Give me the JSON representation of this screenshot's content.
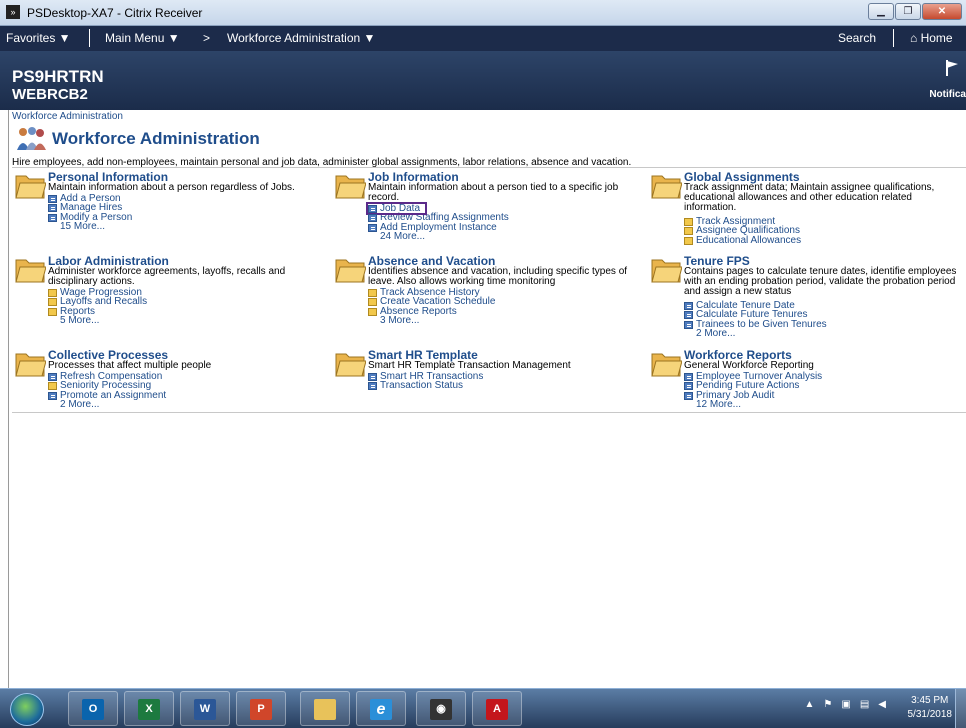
{
  "window": {
    "title": "PSDesktop-XA7 - Citrix Receiver"
  },
  "nav": {
    "favorites": "Favorites ▼",
    "main_menu": "Main Menu ▼",
    "arrow": ">",
    "crumb_menu": "Workforce Administration ▼",
    "search": "Search",
    "home": "Home"
  },
  "header": {
    "line1": "PS9HRTRN",
    "line2": "WEBRCB2",
    "notifications": "Notifica"
  },
  "breadcrumb": "Workforce Administration",
  "page": {
    "title": "Workforce Administration",
    "description": "Hire employees, add non-employees, maintain personal and job data, administer global assignments, labor relations, absence and vacation."
  },
  "sections": {
    "personal_information": {
      "title": "Personal Information",
      "desc": "Maintain information about a person regardless of Jobs.",
      "links": [
        "Add a Person",
        "Manage Hires",
        "Modify a Person"
      ],
      "more": "15 More..."
    },
    "job_information": {
      "title": "Job Information",
      "desc": "Maintain information about a person tied to a specific job record.",
      "links": [
        "Job Data",
        "Review Staffing Assignments",
        "Add Employment Instance"
      ],
      "more": "24 More..."
    },
    "global_assignments": {
      "title": "Global Assignments",
      "desc": "Track assignment data; Maintain assignee qualifications, educational allowances and other education related information.",
      "links": [
        "Track Assignment",
        "Assignee Qualifications",
        "Educational Allowances"
      ]
    },
    "labor_administration": {
      "title": "Labor Administration",
      "desc": "Administer workforce agreements, layoffs, recalls and disciplinary actions.",
      "links": [
        "Wage Progression",
        "Layoffs and Recalls",
        "Reports"
      ],
      "more": "5 More..."
    },
    "absence_vacation": {
      "title": "Absence and Vacation",
      "desc": "Identifies absence and vacation, including specific types of leave. Also allows working time monitoring",
      "links": [
        "Track Absence History",
        "Create Vacation Schedule",
        "Absence Reports"
      ],
      "more": "3 More..."
    },
    "tenure_fps": {
      "title": "Tenure FPS",
      "desc": "Contains pages to calculate tenure dates, identifie employees with an ending probation period, validate the probation period and assign a new status",
      "links": [
        "Calculate Tenure Date",
        "Calculate Future Tenures",
        "Trainees to be Given Tenures"
      ],
      "more": "2 More..."
    },
    "collective_processes": {
      "title": "Collective Processes",
      "desc": "Processes that affect multiple people",
      "links": [
        "Refresh Compensation",
        "Seniority Processing",
        "Promote an Assignment"
      ],
      "more": "2 More..."
    },
    "smart_hr_template": {
      "title": "Smart HR Template",
      "desc": "Smart HR Template Transaction Management",
      "links": [
        "Smart HR Transactions",
        "Transaction Status"
      ]
    },
    "workforce_reports": {
      "title": "Workforce Reports",
      "desc": "General Workforce Reporting",
      "links": [
        "Employee Turnover Analysis",
        "Pending Future Actions",
        "Primary Job Audit"
      ],
      "more": "12 More..."
    }
  },
  "taskbar": {
    "apps": [
      {
        "name": "outlook-icon",
        "label": "O",
        "color": "#0a64ad"
      },
      {
        "name": "excel-icon",
        "label": "X",
        "color": "#1d7a3f"
      },
      {
        "name": "word-icon",
        "label": "W",
        "color": "#2b5797"
      },
      {
        "name": "powerpoint-icon",
        "label": "P",
        "color": "#d0462a"
      },
      {
        "name": "explorer-icon",
        "label": "",
        "color": "#e8c25a"
      },
      {
        "name": "ie-icon",
        "label": "e",
        "color": "#2b8fd8"
      },
      {
        "name": "citrix-icon",
        "label": "◉",
        "color": "#333333"
      },
      {
        "name": "acrobat-icon",
        "label": "A",
        "color": "#c4161c"
      }
    ],
    "time": "3:45 PM",
    "date": "5/31/2018"
  },
  "colors": {
    "nav_bg": "#1c2b4a",
    "link": "#1f4d8b",
    "highlight": "#5b2a8a"
  }
}
